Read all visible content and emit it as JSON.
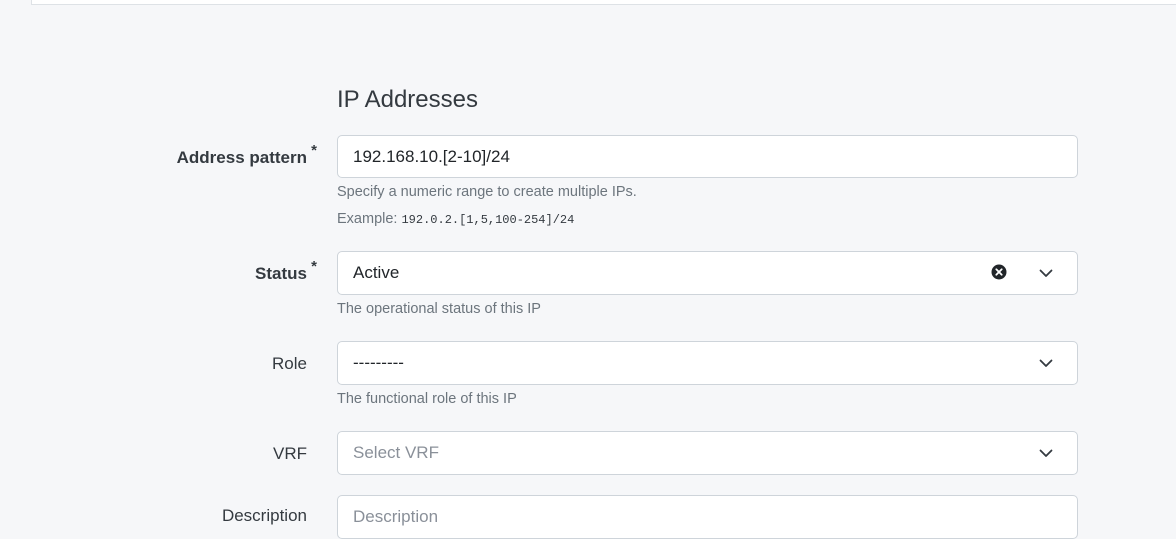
{
  "section": {
    "title": "IP Addresses"
  },
  "fields": {
    "address_pattern": {
      "label": "Address pattern",
      "required_mark": "*",
      "value": "192.168.10.[2-10]/24",
      "help": "Specify a numeric range to create multiple IPs.",
      "example_label": "Example:",
      "example_code": "192.0.2.[1,5,100-254]/24"
    },
    "status": {
      "label": "Status",
      "required_mark": "*",
      "value": "Active",
      "help": "The operational status of this IP"
    },
    "role": {
      "label": "Role",
      "value": "---------",
      "help": "The functional role of this IP"
    },
    "vrf": {
      "label": "VRF",
      "placeholder": "Select VRF"
    },
    "description": {
      "label": "Description",
      "placeholder": "Description"
    }
  },
  "icons": {
    "clear": "clear-selection-icon",
    "chevron": "chevron-down-icon"
  }
}
